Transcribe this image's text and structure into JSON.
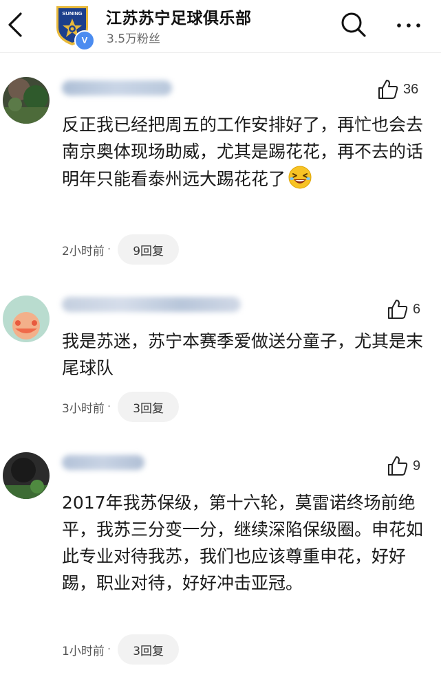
{
  "header": {
    "back_icon": "chevron-left-icon",
    "club_name": "江苏苏宁足球俱乐部",
    "followers": "3.5万粉丝",
    "logo_text": "SUNING",
    "verified_badge": "V",
    "search_icon": "search-icon",
    "more_icon": "more-icon"
  },
  "comments": [
    {
      "text": "反正我已经把周五的工作安排好了，再忙也会去南京奥体现场助威，尤其是踢花花，再不去的话明年只能看泰州远大踢花花了",
      "emoji": "laughing-emoji",
      "likes": "36",
      "time": "2小时前",
      "separator": "·",
      "replies": "9回复"
    },
    {
      "text": "我是苏迷，苏宁本赛季爱做送分童子，尤其是末尾球队",
      "likes": "6",
      "time": "3小时前",
      "separator": "·",
      "replies": "3回复"
    },
    {
      "text": "2017年我苏保级，第十六轮，莫雷诺终场前绝平，我苏三分变一分，继续深陷保级圈。申花如此专业对待我苏，我们也应该尊重申花，好好踢，职业对待，好好冲击亚冠。",
      "likes": "9",
      "time": "1小时前",
      "separator": "·",
      "replies": "3回复"
    }
  ],
  "colors": {
    "text_primary": "#1a1a1a",
    "text_secondary": "#555555",
    "pill_bg": "#f2f2f2",
    "verified_blue": "#4b8cf0",
    "logo_navy": "#1c3f8c",
    "logo_gold": "#e8b93a"
  }
}
